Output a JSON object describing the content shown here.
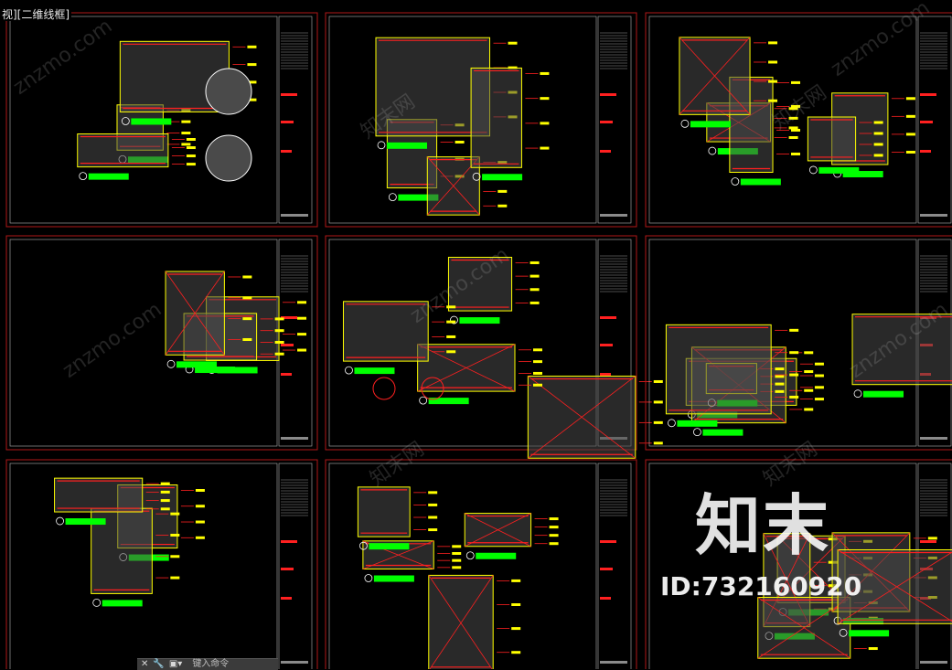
{
  "viewport": {
    "label": "视][二维线框]"
  },
  "command_line": {
    "placeholder": "键入命令"
  },
  "watermark": {
    "brand": "知末",
    "id": "ID:732160920",
    "site_cn": "知末网",
    "site_url": "znzmo.com"
  },
  "colors": {
    "background": "#000000",
    "frame": "#b01818",
    "line_red": "#ff2020",
    "line_yellow": "#ffff00",
    "line_green": "#00ff00",
    "line_white": "#ffffff",
    "line_gray": "#8a8a8a",
    "fill_gray": "#4a4a4a",
    "label_green": "#00ff00"
  },
  "sheets": [
    {
      "id": "1-1"
    },
    {
      "id": "1-2"
    },
    {
      "id": "1-3"
    },
    {
      "id": "2-1"
    },
    {
      "id": "2-2"
    },
    {
      "id": "2-3"
    },
    {
      "id": "3-1"
    },
    {
      "id": "3-2"
    },
    {
      "id": "3-3"
    }
  ]
}
